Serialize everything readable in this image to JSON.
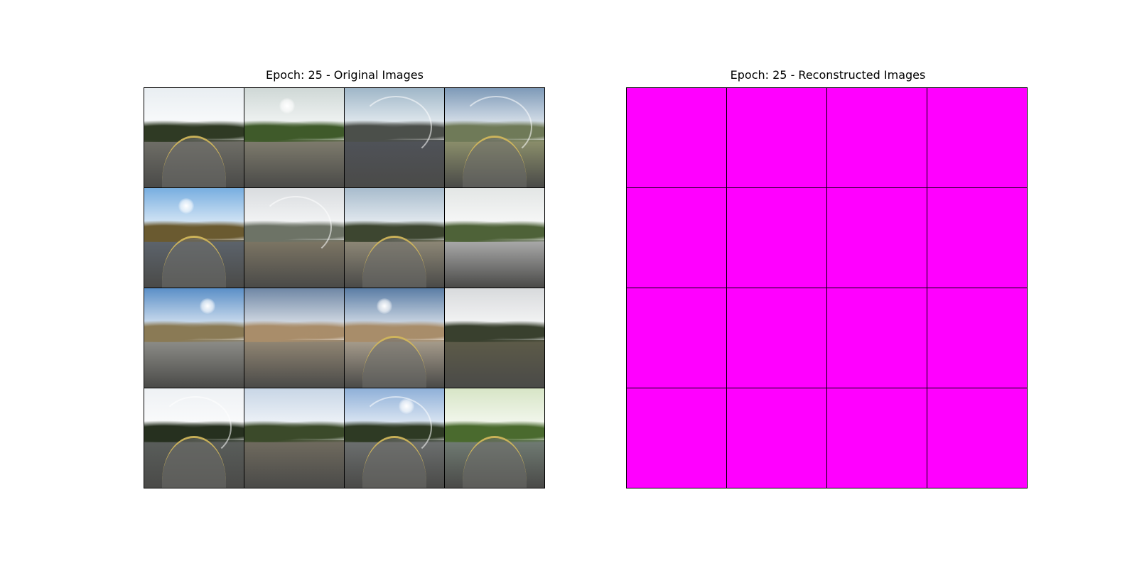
{
  "left_panel": {
    "title": "Epoch: 25 - Original Images",
    "tiles": [
      {
        "sky": "#e9eef2",
        "trees": "#2f3a24",
        "ground": "#6e6d66",
        "road": true,
        "sun": false,
        "arc": false
      },
      {
        "sky": "#cfd8d6",
        "trees": "#3f5a2a",
        "ground": "#7d7a6c",
        "road": false,
        "sun": true,
        "arc": false
      },
      {
        "sky": "#9fb6c8",
        "trees": "#4b4f4a",
        "ground": "#4f5258",
        "road": false,
        "sun": false,
        "arc": true
      },
      {
        "sky": "#7e9ab8",
        "trees": "#6f7a58",
        "ground": "#8a8d6a",
        "road": true,
        "sun": false,
        "arc": true
      },
      {
        "sky": "#78aee0",
        "trees": "#6a5a30",
        "ground": "#5c636b",
        "road": true,
        "sun": true,
        "arc": false
      },
      {
        "sky": "#d9dcdf",
        "trees": "#6d7366",
        "ground": "#7b7463",
        "road": false,
        "sun": false,
        "arc": true
      },
      {
        "sky": "#a8bccd",
        "trees": "#3d4630",
        "ground": "#8c8675",
        "road": true,
        "sun": false,
        "arc": false
      },
      {
        "sky": "#e3e6e5",
        "trees": "#4e6238",
        "ground": "#a7a7a7",
        "road": false,
        "sun": false,
        "arc": false
      },
      {
        "sky": "#5b8fc7",
        "trees": "#8a7a55",
        "ground": "#8b8b86",
        "road": false,
        "sun": true,
        "arc": false
      },
      {
        "sky": "#6f87a5",
        "trees": "#a98d6a",
        "ground": "#8f8472",
        "road": false,
        "sun": false,
        "arc": false
      },
      {
        "sky": "#5b7da5",
        "trees": "#a88d6a",
        "ground": "#a49a8a",
        "road": true,
        "sun": true,
        "arc": false
      },
      {
        "sky": "#d8dadc",
        "trees": "#39402e",
        "ground": "#5c5a48",
        "road": false,
        "sun": false,
        "arc": false
      },
      {
        "sky": "#eef1f4",
        "trees": "#26301f",
        "ground": "#595d5a",
        "road": true,
        "sun": false,
        "arc": true
      },
      {
        "sky": "#c8d6e6",
        "trees": "#3b4a2a",
        "ground": "#6f6a5e",
        "road": false,
        "sun": false,
        "arc": false
      },
      {
        "sky": "#8fb0d8",
        "trees": "#2e3a24",
        "ground": "#6b6e6e",
        "road": true,
        "sun": true,
        "arc": true
      },
      {
        "sky": "#d7e5c6",
        "trees": "#4a6a2e",
        "ground": "#6f7a72",
        "road": true,
        "sun": false,
        "arc": false
      }
    ]
  },
  "right_panel": {
    "title": "Epoch: 25 - Reconstructed Images",
    "tile_color": "#ff00ff",
    "tile_count": 16
  }
}
